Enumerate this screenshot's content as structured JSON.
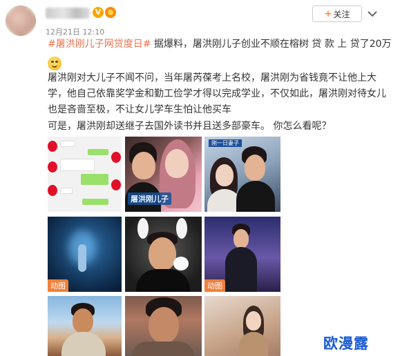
{
  "header": {
    "timestamp": "12月21日 12:10",
    "follow_label": "关注",
    "follow_plus": "+"
  },
  "post": {
    "line1_topic": "#屠洪刚儿子网贷度日#",
    "line1_text": " 据爆料，屠洪刚儿子创业不顺在榕树 贷 款 上 贷了20万",
    "line2": "屠洪刚对大儿子不闻不问，当年屠芮葆考上名校，屠洪刚为省钱竟不让他上大",
    "line3": "学，他自己依靠奖学金和勤工俭学才得以完成学业，不仅如此，屠洪刚对待女儿",
    "line4": "也是吝啬至极，不让女儿学车生怕让他买车",
    "line5": "可是，屠洪刚却送继子去国外读书并且送多部豪车。 你怎么看呢？"
  },
  "images": {
    "caption_t2": "屠洪刚儿子",
    "caption_t3": "刚一日妻子",
    "gif_label": "动图"
  },
  "watermark": "欧漫露",
  "icons": [
    "verified-badge-icon",
    "vip-badge-icon",
    "chevron-down-icon",
    "smile-emoji-icon"
  ],
  "colors": {
    "topic": "#eb7350",
    "follow_plus": "#ff8140",
    "gif_badge": "#f0803c",
    "watermark": "#1a5bd6"
  }
}
